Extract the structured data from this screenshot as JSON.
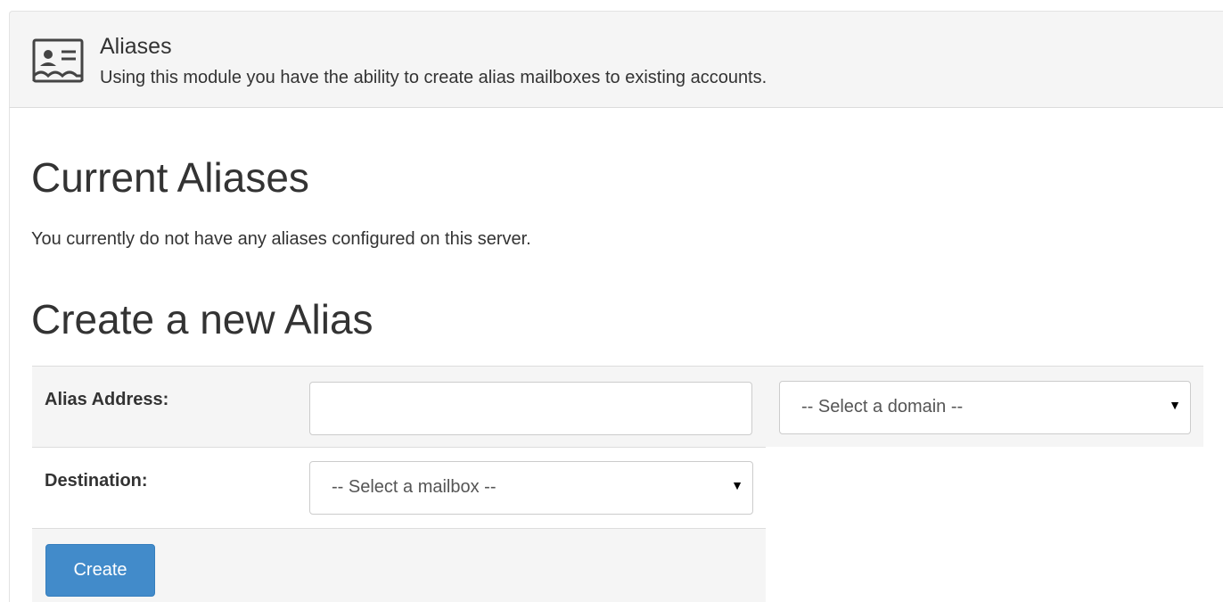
{
  "module": {
    "title": "Aliases",
    "description": "Using this module you have the ability to create alias mailboxes to existing accounts.",
    "icon": "contact-card-icon"
  },
  "current": {
    "heading": "Current Aliases",
    "empty_message": "You currently do not have any aliases configured on this server."
  },
  "create": {
    "heading": "Create a new Alias",
    "alias_label": "Alias Address:",
    "alias_value": "",
    "domain_selected": "-- Select a domain --",
    "destination_label": "Destination:",
    "mailbox_selected": "-- Select a mailbox --",
    "button_label": "Create"
  },
  "colors": {
    "primary": "#428bca",
    "header_bg": "#f5f5f5"
  }
}
